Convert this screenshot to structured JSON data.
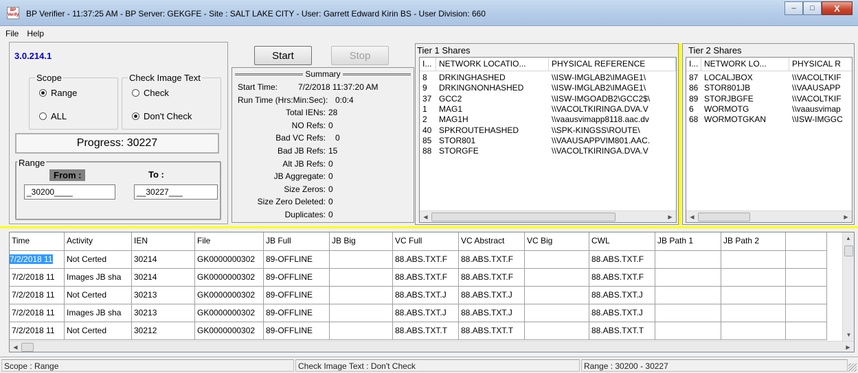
{
  "window": {
    "title": "BP Verifier  - 11:37:25 AM -  BP Server: GEKGFE  - Site : SALT LAKE CITY  -   User: Garrett Edward Kirin BS  -   User Division: 660",
    "app_icon_text": "BP Verify",
    "minimize_glyph": "–",
    "maximize_glyph": "□",
    "close_glyph": "X"
  },
  "menu": {
    "file": "File",
    "help": "Help"
  },
  "left": {
    "version": "3.0.214.1",
    "scope": {
      "title": "Scope",
      "range": "Range",
      "all": "ALL",
      "selected": "range"
    },
    "check_image_text": {
      "title": "Check Image Text",
      "check": "Check",
      "dont_check": "Don't Check",
      "selected": "dont_check"
    },
    "progress": "Progress: 30227",
    "range": {
      "title": "Range",
      "from_label": "From :",
      "to_label": "To :",
      "from_value": "_30200____",
      "to_value": "__30227___"
    }
  },
  "controls": {
    "start": "Start",
    "stop": "Stop"
  },
  "summary": {
    "title": "Summary",
    "rows": [
      {
        "label": "Start Time:",
        "value": "7/2/2018 11:37:20 AM"
      },
      {
        "label": "Run Time (Hrs:Min:Sec):",
        "value": "0:0:4"
      },
      {
        "label": "Total IENs:",
        "value": "28"
      },
      {
        "label": "NO Refs:",
        "value": "0"
      },
      {
        "label": "Bad VC Refs:",
        "value": "0"
      },
      {
        "label": "Bad JB Refs:",
        "value": "15"
      },
      {
        "label": "Alt JB Refs:",
        "value": "0"
      },
      {
        "label": "JB Aggregate:",
        "value": "0"
      },
      {
        "label": "Size Zeros:",
        "value": "0"
      },
      {
        "label": "Size Zero Deleted:",
        "value": "0"
      },
      {
        "label": "Duplicates:",
        "value": "0"
      }
    ]
  },
  "tier1": {
    "title": "Tier 1 Shares",
    "headers": [
      "I...",
      "NETWORK LOCATIO...",
      "PHYSICAL REFERENCE"
    ],
    "rows": [
      [
        "8",
        "DRKINGHASHED",
        "\\\\ISW-IMGLAB2\\IMAGE1\\"
      ],
      [
        "9",
        "DRKINGNONHASHED",
        "\\\\ISW-IMGLAB2\\IMAGE1\\"
      ],
      [
        "37",
        "GCC2",
        "\\\\ISW-IMGOADB2\\GCC2$\\"
      ],
      [
        "1",
        "MAG1",
        "\\\\VACOLTKIRINGA.DVA.V"
      ],
      [
        "2",
        "MAG1H",
        "\\\\vaausvimapp8118.aac.dv"
      ],
      [
        "40",
        "SPKROUTEHASHED",
        "\\\\SPK-KINGSS\\ROUTE\\"
      ],
      [
        "85",
        "STOR801",
        "\\\\VAAUSAPPVIM801.AAC."
      ],
      [
        "88",
        "STORGFE",
        "\\\\VACOLTKIRINGA.DVA.V"
      ]
    ]
  },
  "tier2": {
    "title": "Tier 2 Shares",
    "headers": [
      "I...",
      "NETWORK LO...",
      "PHYSICAL R"
    ],
    "rows": [
      [
        "87",
        "LOCALJBOX",
        "\\\\VACOLTKIF"
      ],
      [
        "86",
        "STOR801JB",
        "\\\\VAAUSAPP"
      ],
      [
        "89",
        "STORJBGFE",
        "\\\\VACOLTKIF"
      ],
      [
        "6",
        "WORMOTG",
        "\\\\vaausvimap"
      ],
      [
        "68",
        "WORMOTGKAN",
        "\\\\ISW-IMGGC"
      ]
    ]
  },
  "results": {
    "headers": [
      "Time",
      "Activity",
      "IEN",
      "File",
      "JB Full",
      "JB Big",
      "VC Full",
      "VC Abstract",
      "VC Big",
      "CWL",
      "JB Path 1",
      "JB Path 2",
      ""
    ],
    "rows": [
      [
        "7/2/2018 11",
        "Not Certed",
        "30214",
        "GK0000000302",
        "89-OFFLINE",
        "",
        "88.ABS.TXT.F",
        "88.ABS.TXT.F",
        "",
        "88.ABS.TXT.F",
        "",
        "",
        ""
      ],
      [
        "7/2/2018 11",
        "Images JB sha",
        "30214",
        "GK0000000302",
        "89-OFFLINE",
        "",
        "88.ABS.TXT.F",
        "88.ABS.TXT.F",
        "",
        "88.ABS.TXT.F",
        "",
        "",
        ""
      ],
      [
        "7/2/2018 11",
        "Not Certed",
        "30213",
        "GK0000000302",
        "89-OFFLINE",
        "",
        "88.ABS.TXT.J",
        "88.ABS.TXT.J",
        "",
        "88.ABS.TXT.J",
        "",
        "",
        ""
      ],
      [
        "7/2/2018 11",
        "Images JB sha",
        "30213",
        "GK0000000302",
        "89-OFFLINE",
        "",
        "88.ABS.TXT.J",
        "88.ABS.TXT.J",
        "",
        "88.ABS.TXT.J",
        "",
        "",
        ""
      ],
      [
        "7/2/2018 11",
        "Not Certed",
        "30212",
        "GK0000000302",
        "89-OFFLINE",
        "",
        "88.ABS.TXT.T",
        "88.ABS.TXT.T",
        "",
        "88.ABS.TXT.T",
        "",
        "",
        ""
      ]
    ],
    "selected_cell_text": "7/2/2018 11"
  },
  "status": {
    "scope": "Scope : Range",
    "check": "Check Image Text : Don't Check",
    "range": "Range :  30200 -  30227"
  },
  "colors": {
    "splitter": "#ffff00",
    "version": "#0000cc",
    "selection": "#3399ff",
    "from_label_bg": "#808080"
  }
}
